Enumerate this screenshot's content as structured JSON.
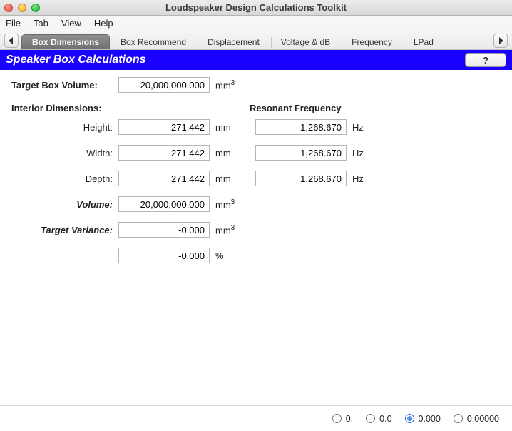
{
  "window": {
    "title": "Loudspeaker Design Calculations Toolkit"
  },
  "menubar": [
    "File",
    "Tab",
    "View",
    "Help"
  ],
  "tabs": {
    "items": [
      "Box Dimensions",
      "Box Recommend",
      "Displacement",
      "Voltage & dB",
      "Frequency",
      "LPad"
    ],
    "selected_index": 0
  },
  "section": {
    "title": "Speaker Box Calculations",
    "help_label": "?"
  },
  "labels": {
    "target_box_volume": "Target Box Volume:",
    "interior_dimensions": "Interior Dimensions:",
    "resonant_frequency": "Resonant Frequency",
    "height": "Height:",
    "width": "Width:",
    "depth": "Depth:",
    "volume": "Volume:",
    "target_variance": "Target Variance:"
  },
  "values": {
    "target_box_volume": "20,000,000.000",
    "height": "271.442",
    "width": "271.442",
    "depth": "271.442",
    "volume": "20,000,000.000",
    "target_variance": "-0.000",
    "target_variance_pct": "-0.000",
    "freq_height": "1,268.670",
    "freq_width": "1,268.670",
    "freq_depth": "1,268.670"
  },
  "units": {
    "mm": "mm",
    "mm3": "mm",
    "mm3_sup": "3",
    "hz": "Hz",
    "pct": "%"
  },
  "precision": {
    "options": [
      "0.",
      "0.0",
      "0.000",
      "0.00000"
    ],
    "selected_index": 2
  }
}
